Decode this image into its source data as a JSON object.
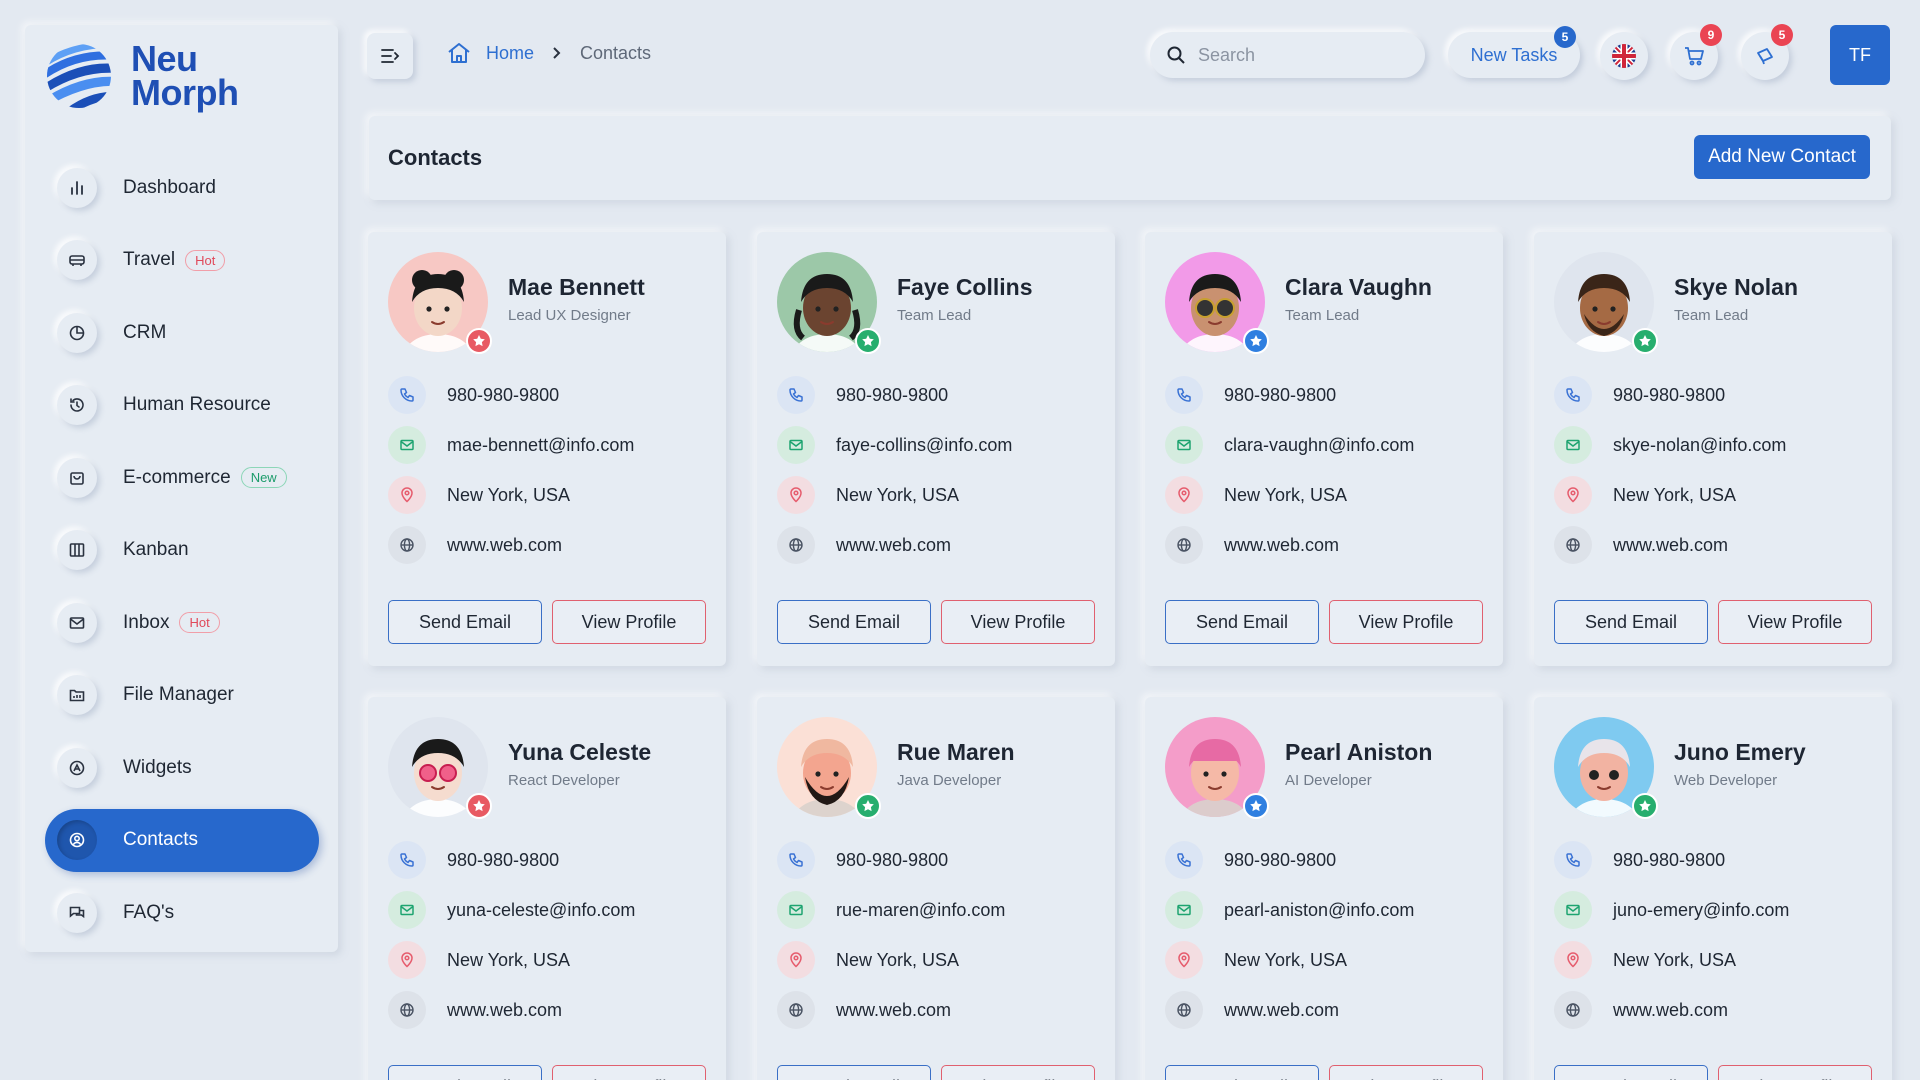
{
  "brand": {
    "line1": "Neu",
    "line2": "Morph"
  },
  "sidebar": {
    "items": [
      {
        "label": "Dashboard",
        "icon": "bar-chart-icon",
        "badge": ""
      },
      {
        "label": "Travel",
        "icon": "car-icon",
        "badge": "Hot"
      },
      {
        "label": "CRM",
        "icon": "pie-chart-icon",
        "badge": ""
      },
      {
        "label": "Human Resource",
        "icon": "history-icon",
        "badge": ""
      },
      {
        "label": "E-commerce",
        "icon": "shopping-bag-icon",
        "badge": "New"
      },
      {
        "label": "Kanban",
        "icon": "columns-icon",
        "badge": ""
      },
      {
        "label": "Inbox",
        "icon": "inbox-icon",
        "badge": "Hot"
      },
      {
        "label": "File Manager",
        "icon": "folder-icon",
        "badge": ""
      },
      {
        "label": "Widgets",
        "icon": "widget-icon",
        "badge": ""
      },
      {
        "label": "Contacts",
        "icon": "contact-icon",
        "badge": "",
        "active": true
      },
      {
        "label": "FAQ's",
        "icon": "chat-icon",
        "badge": ""
      }
    ]
  },
  "topbar": {
    "breadcrumb": {
      "home": "Home",
      "current": "Contacts"
    },
    "search_placeholder": "Search",
    "new_tasks_label": "New Tasks",
    "new_tasks_count": "5",
    "cart_count": "9",
    "notifications_count": "5",
    "user_initials": "TF"
  },
  "page": {
    "title": "Contacts",
    "add_button": "Add New Contact"
  },
  "buttons": {
    "send": "Send Email",
    "view": "View Profile"
  },
  "contacts": [
    {
      "name": "Mae Bennett",
      "role": "Lead UX Designer",
      "phone": "980-980-9800",
      "email": "mae-bennett@info.com",
      "location": "New York, USA",
      "website": "www.web.com",
      "avatar_bg": "#f7c8c4",
      "star_color": "#e85a63"
    },
    {
      "name": "Faye Collins",
      "role": "Team Lead",
      "phone": "980-980-9800",
      "email": "faye-collins@info.com",
      "location": "New York, USA",
      "website": "www.web.com",
      "avatar_bg": "#9cc8a8",
      "star_color": "#27ae6e"
    },
    {
      "name": "Clara Vaughn",
      "role": "Team Lead",
      "phone": "980-980-9800",
      "email": "clara-vaughn@info.com",
      "location": "New York, USA",
      "website": "www.web.com",
      "avatar_bg": "#f29ae8",
      "star_color": "#2f7fe0"
    },
    {
      "name": "Skye Nolan",
      "role": "Team Lead",
      "phone": "980-980-9800",
      "email": "skye-nolan@info.com",
      "location": "New York, USA",
      "website": "www.web.com",
      "avatar_bg": "#dfe5ee",
      "star_color": "#27ae6e"
    },
    {
      "name": "Yuna Celeste",
      "role": "React Developer",
      "phone": "980-980-9800",
      "email": "yuna-celeste@info.com",
      "location": "New York, USA",
      "website": "www.web.com",
      "avatar_bg": "#dfe5ee",
      "star_color": "#e85a63"
    },
    {
      "name": "Rue Maren",
      "role": "Java Developer",
      "phone": "980-980-9800",
      "email": "rue-maren@info.com",
      "location": "New York, USA",
      "website": "www.web.com",
      "avatar_bg": "#fbe0d6",
      "star_color": "#27ae6e"
    },
    {
      "name": "Pearl Aniston",
      "role": "AI Developer",
      "phone": "980-980-9800",
      "email": "pearl-aniston@info.com",
      "location": "New York, USA",
      "website": "www.web.com",
      "avatar_bg": "#f49dc9",
      "star_color": "#2f7fe0"
    },
    {
      "name": "Juno Emery",
      "role": "Web Developer",
      "phone": "980-980-9800",
      "email": "juno-emery@info.com",
      "location": "New York, USA",
      "website": "www.web.com",
      "avatar_bg": "#7fcaf0",
      "star_color": "#27ae6e"
    }
  ],
  "colors": {
    "accent": "#2768cc",
    "hot": "#e0495a",
    "new": "#1c9c6b",
    "background": "#e3e9f1"
  }
}
